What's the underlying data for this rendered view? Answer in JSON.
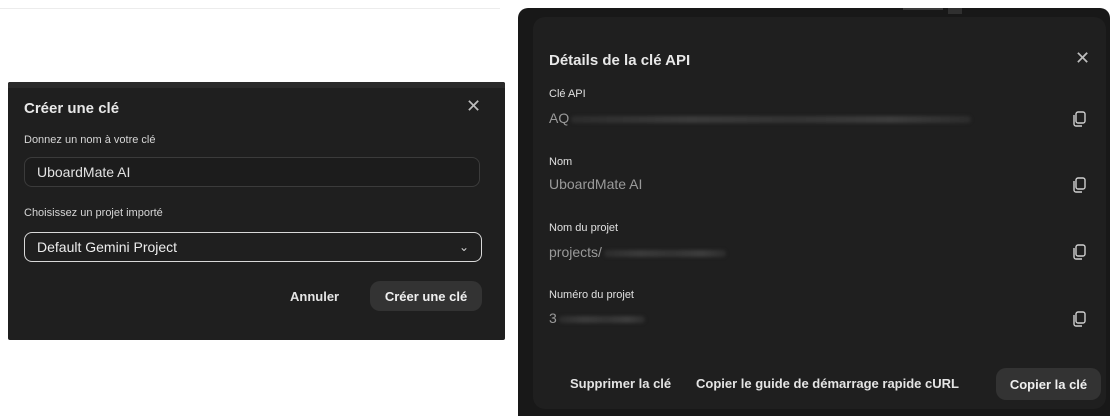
{
  "create_dialog": {
    "title": "Créer une clé",
    "name_label": "Donnez un nom à votre clé",
    "name_value": "UboardMate AI",
    "project_label": "Choisissez un projet importé",
    "project_selected": "Default Gemini Project",
    "cancel_label": "Annuler",
    "create_label": "Créer une clé",
    "close_icon": "close-icon",
    "dropdown_icon": "chevron-down-icon"
  },
  "details_dialog": {
    "title": "Détails de la clé API",
    "fields": [
      {
        "label": "Clé API",
        "value": "AQ"
      },
      {
        "label": "Nom",
        "value": "UboardMate AI"
      },
      {
        "label": "Nom du projet",
        "value": "projects/"
      },
      {
        "label": "Numéro du projet",
        "value": "3"
      }
    ],
    "delete_label": "Supprimer la clé",
    "curl_label": "Copier le guide de démarrage rapide cURL",
    "copy_key_label": "Copier la clé",
    "close_icon": "close-icon",
    "copy_icon": "copy-icon"
  }
}
